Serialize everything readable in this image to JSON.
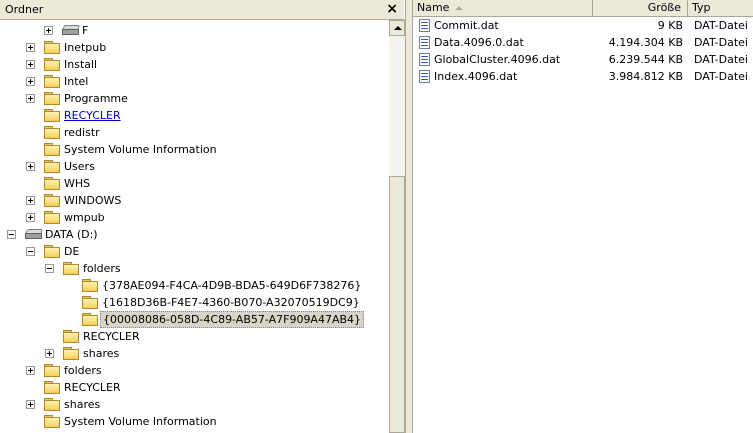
{
  "tree_panel": {
    "title": "Ordner",
    "close_label": "×"
  },
  "tree": [
    {
      "label": "F",
      "icon": "drive",
      "expander": "plus"
    },
    {
      "label": "Inetpub",
      "icon": "folder",
      "expander": "plus"
    },
    {
      "label": "Install",
      "icon": "folder",
      "expander": "plus"
    },
    {
      "label": "Intel",
      "icon": "folder",
      "expander": "plus"
    },
    {
      "label": "Programme",
      "icon": "folder",
      "expander": "plus"
    },
    {
      "label": "RECYCLER",
      "icon": "folder",
      "expander": "none",
      "style": "link"
    },
    {
      "label": "redistr",
      "icon": "folder",
      "expander": "none"
    },
    {
      "label": "System Volume Information",
      "icon": "folder",
      "expander": "none"
    },
    {
      "label": "Users",
      "icon": "folder",
      "expander": "plus"
    },
    {
      "label": "WHS",
      "icon": "folder",
      "expander": "none"
    },
    {
      "label": "WINDOWS",
      "icon": "folder",
      "expander": "plus"
    },
    {
      "label": "wmpub",
      "icon": "folder",
      "expander": "plus"
    },
    {
      "label": "DATA (D:)",
      "icon": "drive",
      "expander": "minus"
    },
    {
      "label": "DE",
      "icon": "folder",
      "expander": "minus"
    },
    {
      "label": "folders",
      "icon": "folder",
      "expander": "minus"
    },
    {
      "label": "{378AE094-F4CA-4D9B-BDA5-649D6F738276}",
      "icon": "folder",
      "expander": "none"
    },
    {
      "label": "{1618D36B-F4E7-4360-B070-A32070519DC9}",
      "icon": "folder",
      "expander": "none"
    },
    {
      "label": "{00008086-058D-4C89-AB57-A7F909A47AB4}",
      "icon": "folder",
      "expander": "none",
      "style": "selected"
    },
    {
      "label": "RECYCLER",
      "icon": "folder",
      "expander": "none"
    },
    {
      "label": "shares",
      "icon": "folder",
      "expander": "plus"
    },
    {
      "label": "folders",
      "icon": "folder",
      "expander": "plus"
    },
    {
      "label": "RECYCLER",
      "icon": "folder",
      "expander": "none"
    },
    {
      "label": "shares",
      "icon": "folder",
      "expander": "plus"
    },
    {
      "label": "System Volume Information",
      "icon": "folder",
      "expander": "none"
    }
  ],
  "file_list": {
    "columns": {
      "name": "Name",
      "size": "Größe",
      "type": "Typ"
    },
    "files": [
      {
        "name": "Commit.dat",
        "size": "9 KB",
        "type": "DAT-Datei",
        "icon": "dat-file-icon"
      },
      {
        "name": "Data.4096.0.dat",
        "size": "4.194.304 KB",
        "type": "DAT-Datei",
        "icon": "dat-file-icon"
      },
      {
        "name": "GlobalCluster.4096.dat",
        "size": "6.239.544 KB",
        "type": "DAT-Datei",
        "icon": "dat-file-icon"
      },
      {
        "name": "Index.4096.dat",
        "size": "3.984.812 KB",
        "type": "DAT-Datei",
        "icon": "dat-file-icon"
      }
    ]
  },
  "colors": {
    "chrome": "#ece9d8",
    "border": "#aca899",
    "link": "#0000cc",
    "selected_bg": "#d8d4c8"
  }
}
